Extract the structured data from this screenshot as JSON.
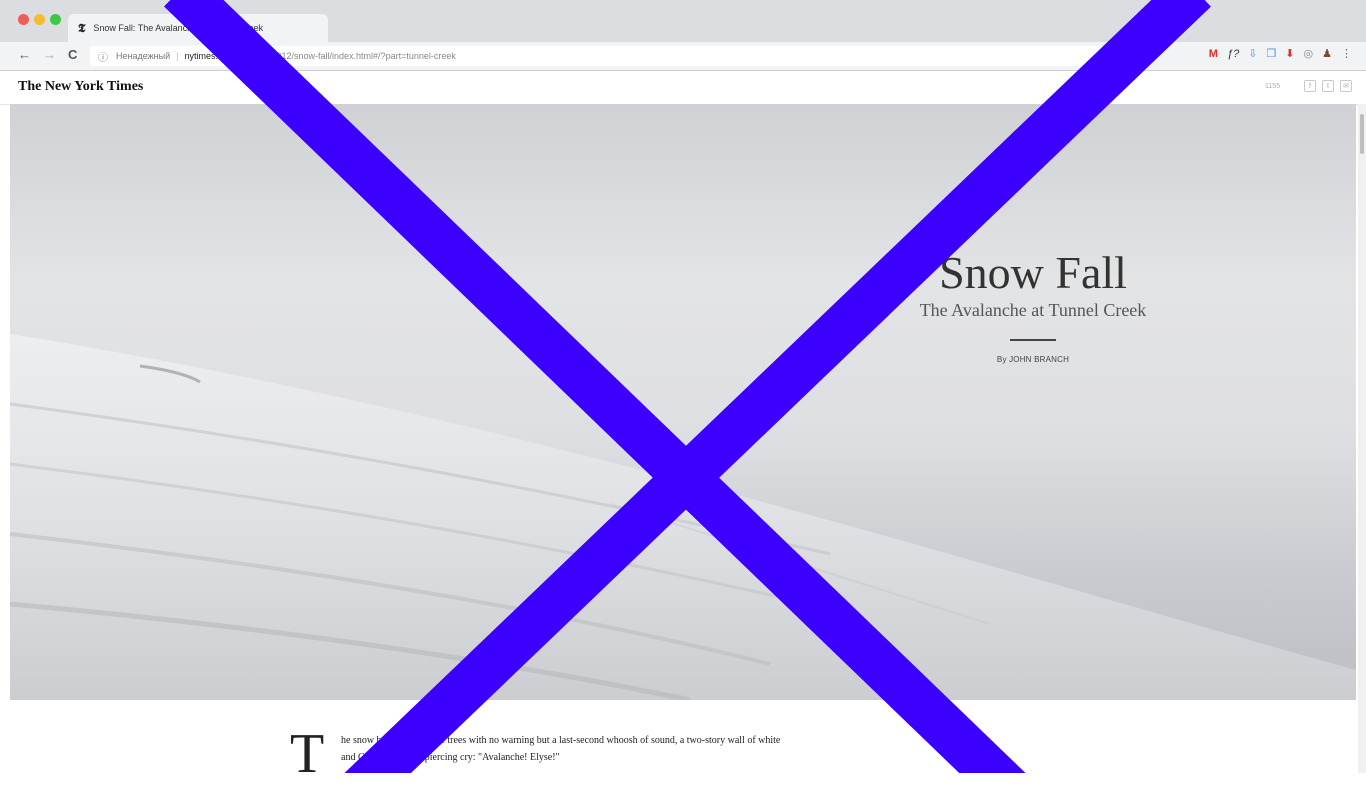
{
  "browser": {
    "tab_favicon": "𝕿",
    "tab_title": "Snow Fall: The Avalanche at Tunnel Creek",
    "nav": {
      "back": "←",
      "forward": "→",
      "reload": "C"
    },
    "omnibox": {
      "info_icon": "ⓘ",
      "security_label": "Ненадежный",
      "separator": "|",
      "host": "nytimes.com",
      "path": "/projects/2012/snow-fall/index.html#/?part=tunnel-creek"
    },
    "extensions": [
      "M",
      "ƒ?",
      "⇩",
      "❐",
      "⬇",
      "◎",
      "♟",
      "⋮"
    ]
  },
  "nyt": {
    "logo": "The New York Times",
    "comment_count": "1155",
    "share_icons": [
      "f",
      "t",
      "✉"
    ]
  },
  "hero": {
    "title": "Snow Fall",
    "subtitle": "The Avalanche at Tunnel Creek",
    "byline": "By JOHN BRANCH"
  },
  "article": {
    "dropcap": "T",
    "paragraph": "he snow burst through the trees with no warning but a last-second whoosh of sound, a two-story wall of white and Chris Rudolph's piercing cry: \"Avalanche! Elyse!\""
  },
  "colors": {
    "overlay_cross": "#3b00ff"
  }
}
